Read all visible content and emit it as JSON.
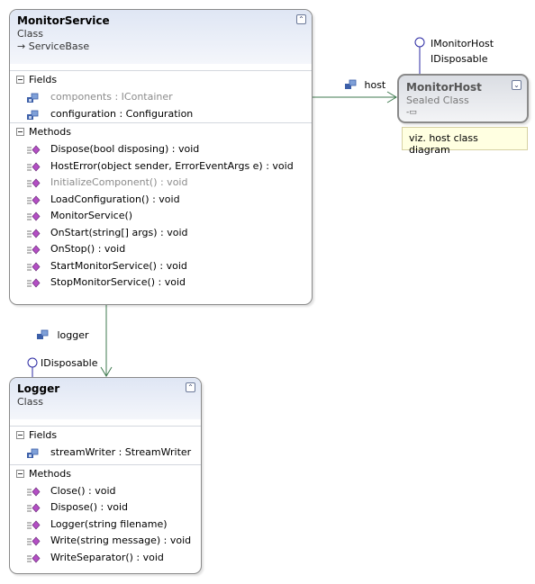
{
  "monitor_service": {
    "title": "MonitorService",
    "kind": "Class",
    "base": "ServiceBase",
    "fields_label": "Fields",
    "fields": [
      {
        "text": "components : IContainer",
        "muted": true
      },
      {
        "text": "configuration : Configuration",
        "muted": false
      }
    ],
    "methods_label": "Methods",
    "methods": [
      {
        "text": "Dispose(bool disposing) : void",
        "muted": false
      },
      {
        "text": "HostError(object sender, ErrorEventArgs e) : void",
        "muted": false
      },
      {
        "text": "InitializeComponent() : void",
        "muted": true
      },
      {
        "text": "LoadConfiguration() : void",
        "muted": false
      },
      {
        "text": "MonitorService()",
        "muted": false
      },
      {
        "text": "OnStart(string[] args) : void",
        "muted": false
      },
      {
        "text": "OnStop() : void",
        "muted": false
      },
      {
        "text": "StartMonitorService() : void",
        "muted": false
      },
      {
        "text": "StopMonitorService() : void",
        "muted": false
      }
    ]
  },
  "monitor_host": {
    "title": "MonitorHost",
    "kind": "Sealed Class",
    "interfaces": [
      "IMonitorHost",
      "IDisposable"
    ]
  },
  "note": {
    "text": "viz. host class diagram"
  },
  "logger": {
    "title": "Logger",
    "kind": "Class",
    "interface": "IDisposable",
    "fields_label": "Fields",
    "fields": [
      {
        "text": "streamWriter : StreamWriter",
        "muted": false
      }
    ],
    "methods_label": "Methods",
    "methods": [
      {
        "text": "Close() : void",
        "muted": false
      },
      {
        "text": "Dispose() : void",
        "muted": false
      },
      {
        "text": "Logger(string filename)",
        "muted": false
      },
      {
        "text": "Write(string message) : void",
        "muted": false
      },
      {
        "text": "WriteSeparator() : void",
        "muted": false
      }
    ]
  },
  "associations": {
    "host": "host",
    "logger": "logger"
  },
  "colors": {
    "association_line": "#3f7a4f",
    "lollipop": "#2b2aa3",
    "header_gradient_top": "#dfe6f4",
    "note_background": "#ffffe1"
  }
}
